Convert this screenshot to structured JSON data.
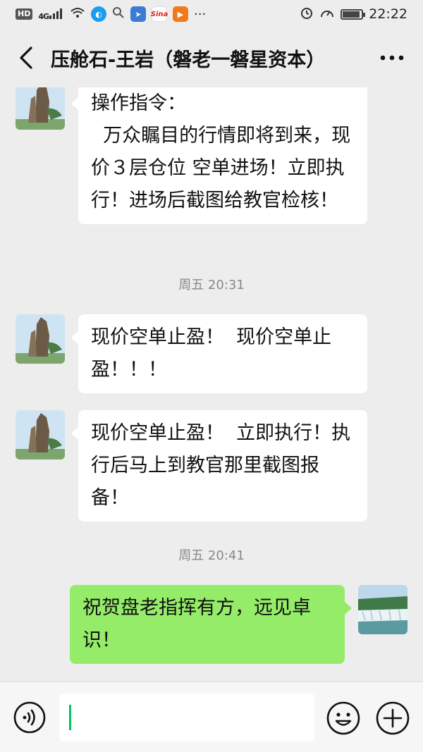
{
  "status_bar": {
    "left_badge": "HD",
    "network": "4G",
    "time": "22:22",
    "icons": [
      "hd-icon",
      "signal-icon",
      "wifi-icon",
      "browser-icon",
      "search-icon",
      "app-icon",
      "sina-icon",
      "video-icon",
      "more-dots-icon",
      "alarm-icon",
      "speedometer-icon",
      "battery-icon"
    ],
    "battery_level": 0.9
  },
  "header": {
    "title": "压舱石-王岩（磐老一磐星资本）",
    "back_icon": "chevron-left-icon",
    "more_icon": "more-icon"
  },
  "messages": [
    {
      "type": "in",
      "text": "操作指令：\n  万众瞩目的行情即将到来，现价３层仓位 空单进场！立即执行！进场后截图给教官检核！"
    },
    {
      "type": "time",
      "text": "周五 20:31"
    },
    {
      "type": "in",
      "text": "现价空单止盈！  现价空单止盈！！！"
    },
    {
      "type": "in",
      "text": "现价空单止盈！  立即执行！执行后马上到教官那里截图报备！"
    },
    {
      "type": "time",
      "text": "周五 20:41"
    },
    {
      "type": "out",
      "text": "祝贺盘老指挥有方，远见卓识！"
    }
  ],
  "input_bar": {
    "voice_icon": "voice-icon",
    "emoji_icon": "emoji-icon",
    "plus_icon": "plus-icon",
    "text_value": ""
  },
  "colors": {
    "background": "#ededed",
    "incoming_bubble": "#ffffff",
    "outgoing_bubble": "#95ec69",
    "caret": "#07c160"
  }
}
